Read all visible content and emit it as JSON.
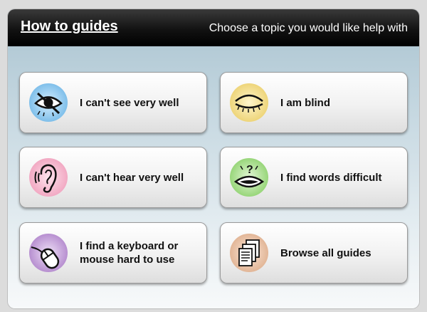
{
  "header": {
    "title": "How to guides",
    "subtitle": "Choose a topic you would like help with"
  },
  "topics": [
    {
      "label": "I can't see very well",
      "icon": "eye-icon",
      "color": "#8ec9f0"
    },
    {
      "label": "I am blind",
      "icon": "closed-eye-icon",
      "color": "#f2df8a"
    },
    {
      "label": "I can't hear very well",
      "icon": "ear-icon",
      "color": "#f4b6cc"
    },
    {
      "label": "I find words difficult",
      "icon": "mouth-question-icon",
      "color": "#a6dd8a"
    },
    {
      "label": "I find a keyboard or mouse hard to use",
      "icon": "mouse-icon",
      "color": "#c09ad6"
    },
    {
      "label": "Browse all guides",
      "icon": "documents-icon",
      "color": "#e9c0a4"
    }
  ]
}
